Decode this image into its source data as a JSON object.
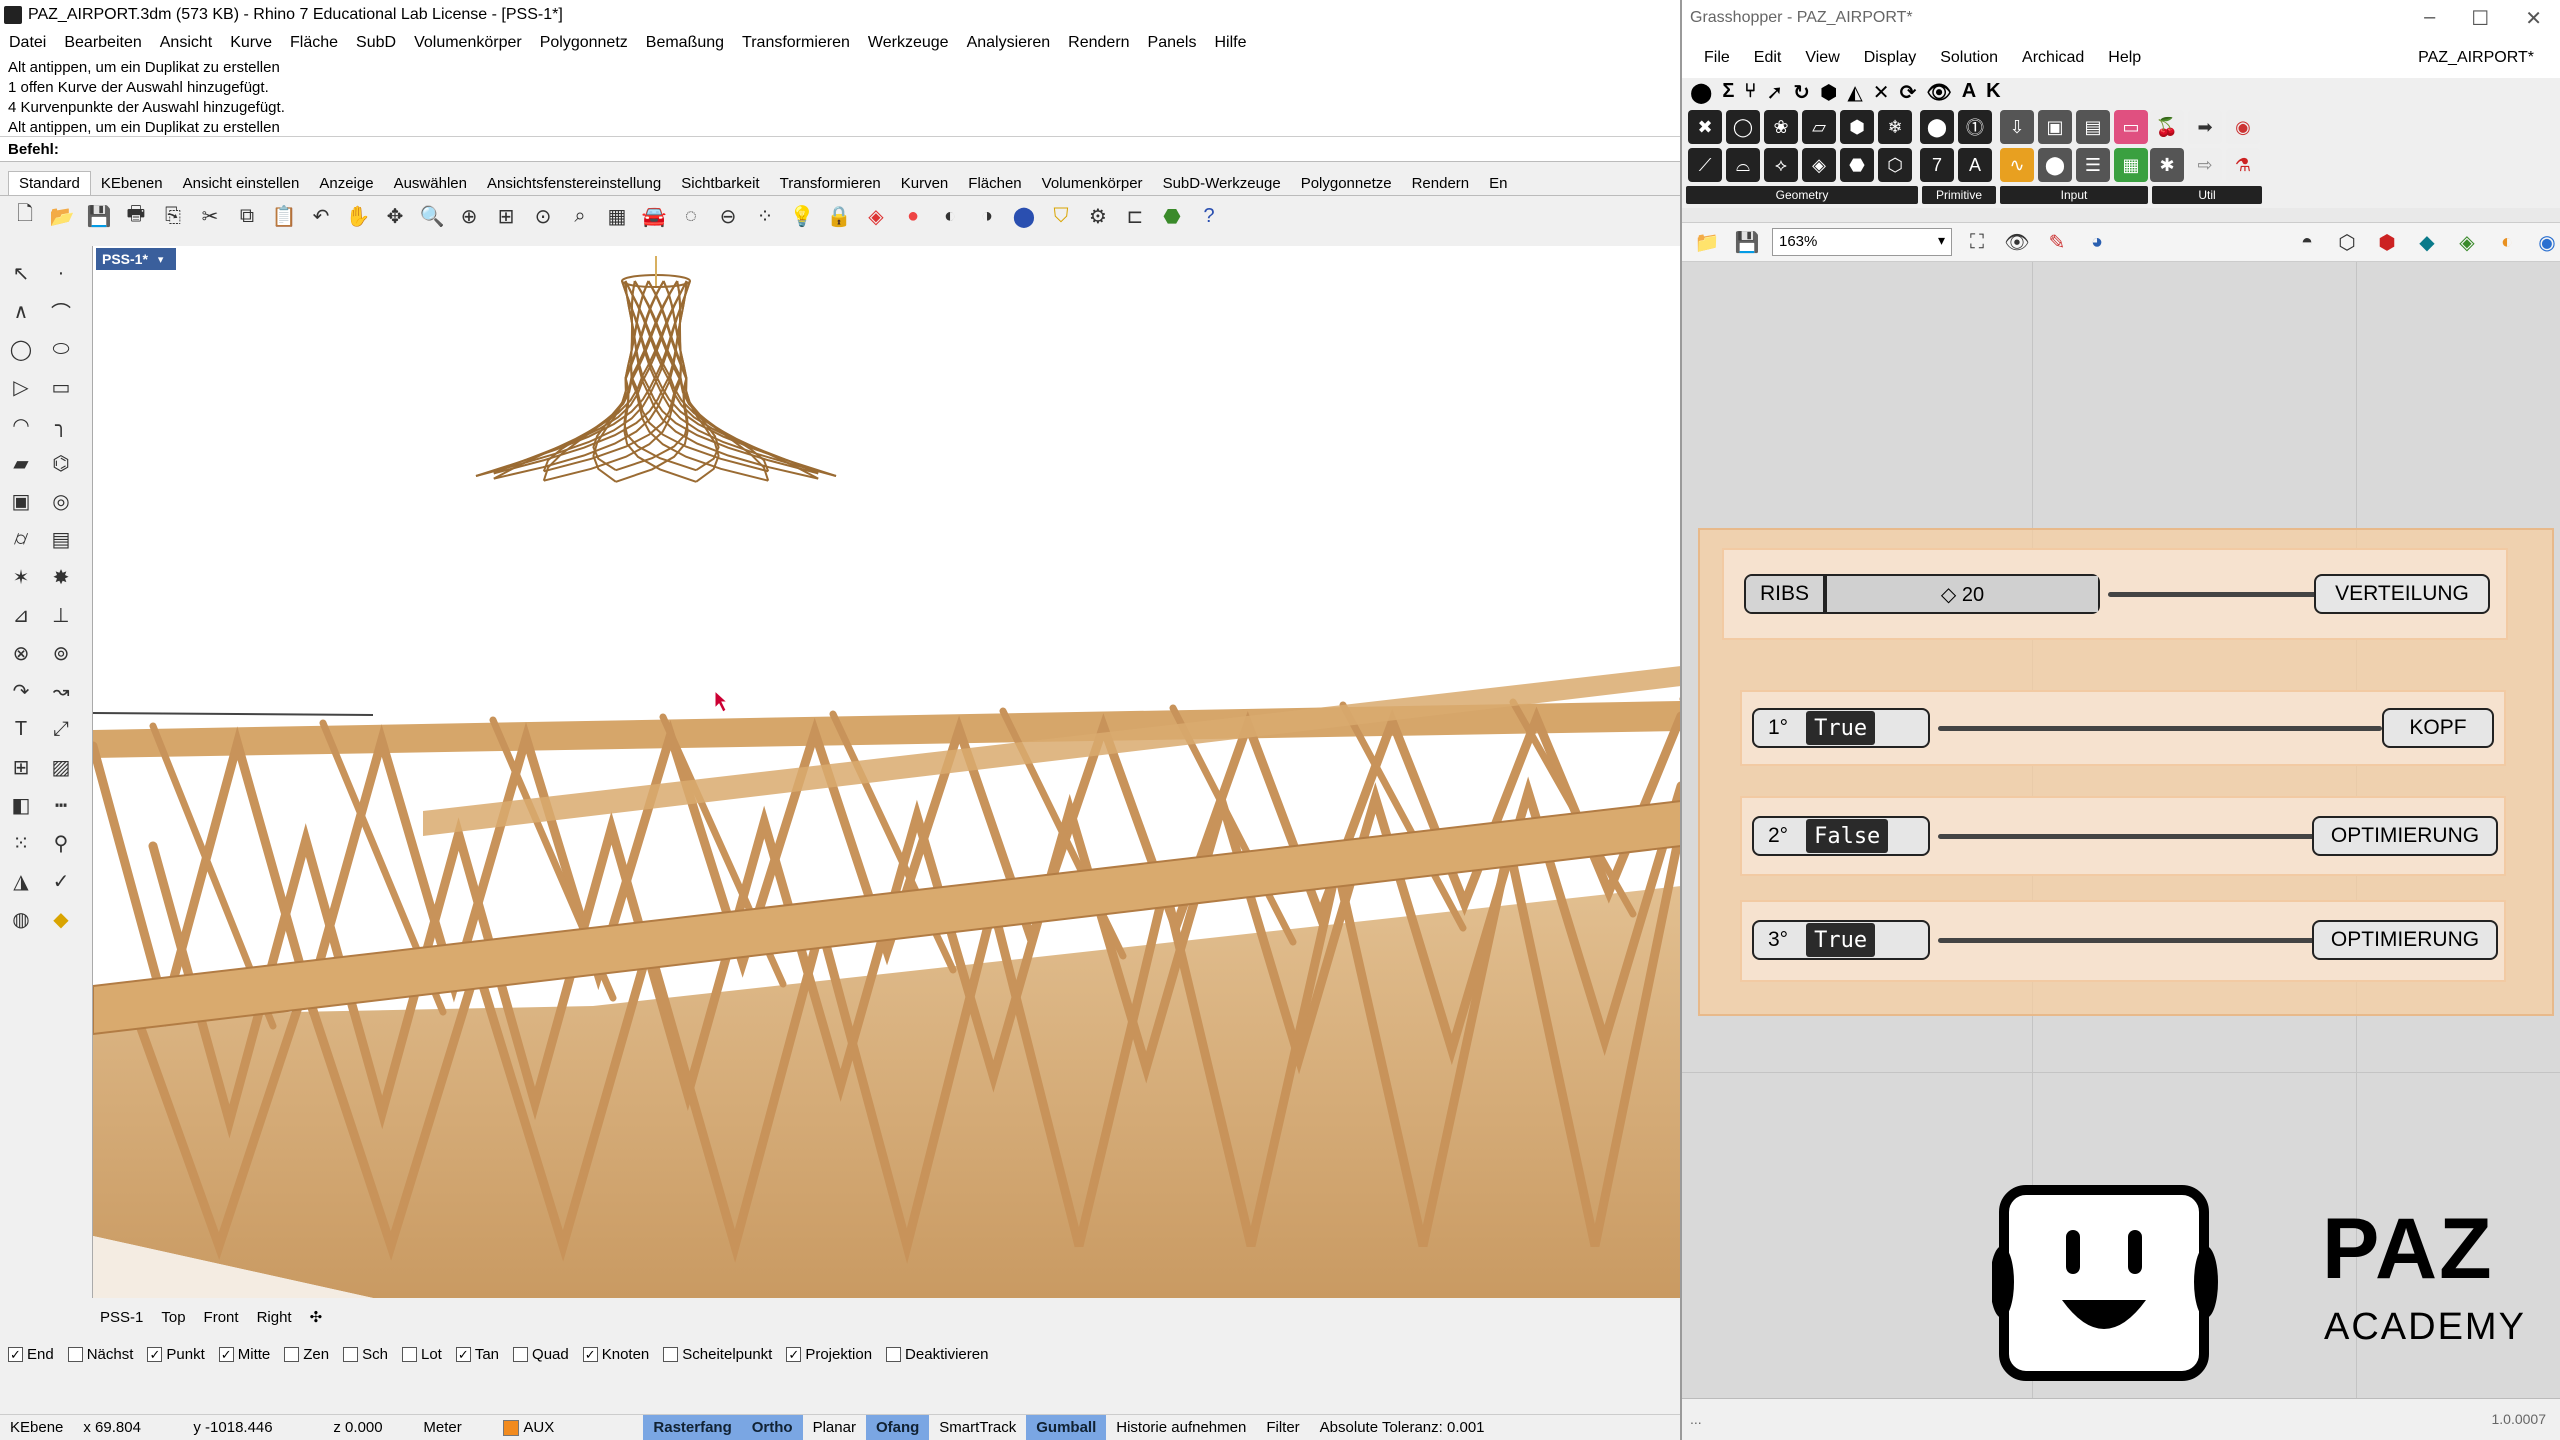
{
  "rhino": {
    "title": "PAZ_AIRPORT.3dm (573 KB) - Rhino 7 Educational Lab License - [PSS-1*]",
    "menu": [
      "Datei",
      "Bearbeiten",
      "Ansicht",
      "Kurve",
      "Fläche",
      "SubD",
      "Volumenkörper",
      "Polygonnetz",
      "Bemaßung",
      "Transformieren",
      "Werkzeuge",
      "Analysieren",
      "Rendern",
      "Panels",
      "Hilfe"
    ],
    "command_history": [
      "Alt antippen, um ein Duplikat zu erstellen",
      "1 offen Kurve der Auswahl hinzugefügt.",
      "4 Kurvenpunkte der Auswahl hinzugefügt.",
      "Alt antippen, um ein Duplikat zu erstellen"
    ],
    "command_prompt": "Befehl:",
    "toolbar_tabs": [
      "Standard",
      "KEbenen",
      "Ansicht einstellen",
      "Anzeige",
      "Auswählen",
      "Ansichtsfenstereinstellung",
      "Sichtbarkeit",
      "Transformieren",
      "Kurven",
      "Flächen",
      "Volumenkörper",
      "SubD-Werkzeuge",
      "Polygonnetze",
      "Rendern",
      "En"
    ],
    "active_toolbar_tab": "Standard",
    "viewport_label": "PSS-1*",
    "view_tabs": [
      "PSS-1",
      "Top",
      "Front",
      "Right"
    ],
    "osnaps": [
      {
        "label": "End",
        "checked": true
      },
      {
        "label": "Nächst",
        "checked": false
      },
      {
        "label": "Punkt",
        "checked": true
      },
      {
        "label": "Mitte",
        "checked": true
      },
      {
        "label": "Zen",
        "checked": false
      },
      {
        "label": "Sch",
        "checked": false
      },
      {
        "label": "Lot",
        "checked": false
      },
      {
        "label": "Tan",
        "checked": true
      },
      {
        "label": "Quad",
        "checked": false
      },
      {
        "label": "Knoten",
        "checked": true
      },
      {
        "label": "Scheitelpunkt",
        "checked": false
      },
      {
        "label": "Projektion",
        "checked": true
      },
      {
        "label": "Deaktivieren",
        "checked": false
      }
    ],
    "status": {
      "layer_mode": "KEbene",
      "x": "x 69.804",
      "y": "y -1018.446",
      "z": "z 0.000",
      "units": "Meter",
      "layer": "AUX",
      "layer_color": "#f28b1e",
      "toggles": [
        {
          "label": "Rasterfang",
          "on": true
        },
        {
          "label": "Ortho",
          "on": true
        },
        {
          "label": "Planar",
          "on": false
        },
        {
          "label": "Ofang",
          "on": true
        },
        {
          "label": "SmartTrack",
          "on": false
        },
        {
          "label": "Gumball",
          "on": true
        },
        {
          "label": "Historie aufnehmen",
          "on": false
        },
        {
          "label": "Filter",
          "on": false
        }
      ],
      "tolerance": "Absolute Toleranz: 0.001"
    }
  },
  "grasshopper": {
    "title": "Grasshopper - PAZ_AIRPORT*",
    "menu": [
      "File",
      "Edit",
      "View",
      "Display",
      "Solution",
      "Archicad",
      "Help"
    ],
    "document_name": "PAZ_AIRPORT*",
    "panels": [
      "Geometry",
      "Primitive",
      "Input",
      "Util"
    ],
    "zoom": "163%",
    "version": "1.0.0007",
    "footer_left": "...",
    "slider": {
      "name": "RIBS",
      "value": "◇ 20",
      "target": "VERTEILUNG"
    },
    "toggles": [
      {
        "name": "1°",
        "value": "True",
        "target": "KOPF"
      },
      {
        "name": "2°",
        "value": "False",
        "target": "OPTIMIERUNG"
      },
      {
        "name": "3°",
        "value": "True",
        "target": "OPTIMIERUNG"
      }
    ],
    "logo": {
      "line1": "PAZ",
      "line2": "ACADEMY"
    }
  }
}
